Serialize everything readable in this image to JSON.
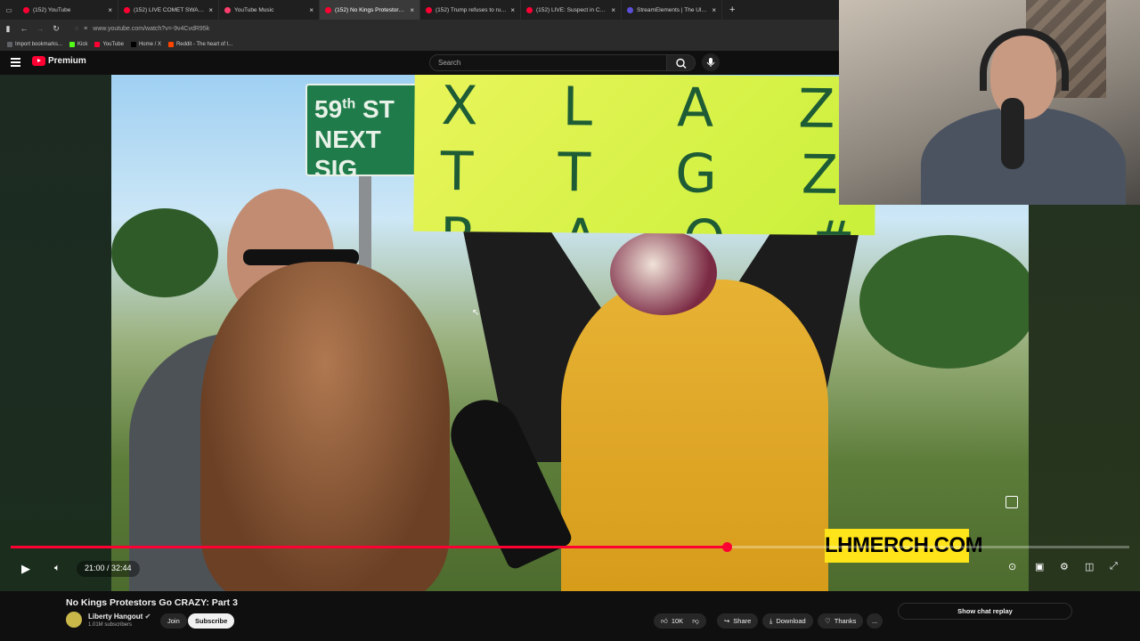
{
  "browser": {
    "tabs": [
      {
        "label": "(152) YouTube",
        "active": false,
        "fav": "youtube"
      },
      {
        "label": "(152) LIVE COMET SWAN AND",
        "active": false,
        "fav": "youtube"
      },
      {
        "label": "YouTube Music",
        "active": false,
        "fav": "music"
      },
      {
        "label": "(152) No Kings Protestors G",
        "active": true,
        "fav": "youtube"
      },
      {
        "label": "(152) Trump refuses to rule out",
        "active": false,
        "fav": "youtube"
      },
      {
        "label": "(152) LIVE: Suspect in Charlie K",
        "active": false,
        "fav": "youtube"
      },
      {
        "label": "StreamElements | The Ultimate",
        "active": false,
        "fav": "se"
      }
    ],
    "new_tab_label": "+",
    "url": "www.youtube.com/watch?v=-9v4CvdR95k",
    "bookmarks": [
      {
        "label": "Import bookmarks...",
        "color": "#5f6368"
      },
      {
        "label": "Kick",
        "color": "#53fc18"
      },
      {
        "label": "YouTube",
        "color": "#ff0033"
      },
      {
        "label": "Home / X",
        "color": "#000000"
      },
      {
        "label": "Reddit - The heart of t...",
        "color": "#ff4500"
      }
    ]
  },
  "youtube": {
    "logo_text": "Premium",
    "search_placeholder": "Search"
  },
  "video": {
    "overlay_text": "LHMERCH.COM",
    "sign_text": "59th St\nNEXT SIG",
    "poster_text": "X L A Z\nT T G Z\nR O  A  O #",
    "current_time": "21:00 / 32:44",
    "progress_fraction": 0.64
  },
  "meta": {
    "title": "No Kings Protestors Go CRAZY: Part 3",
    "channel_name": "Liberty Hangout",
    "verified_icon": "verified-check-icon",
    "subscribers": "1.01M subscribers",
    "join_label": "Join",
    "subscribe_label": "Subscribe",
    "like_count": "10K",
    "share_label": "Share",
    "download_label": "Download",
    "thanks_label": "Thanks",
    "more_label": "...",
    "chat_replay_label": "Show chat replay"
  },
  "colors": {
    "accent": "#ff0033",
    "merch_yellow": "#ffe41a"
  }
}
